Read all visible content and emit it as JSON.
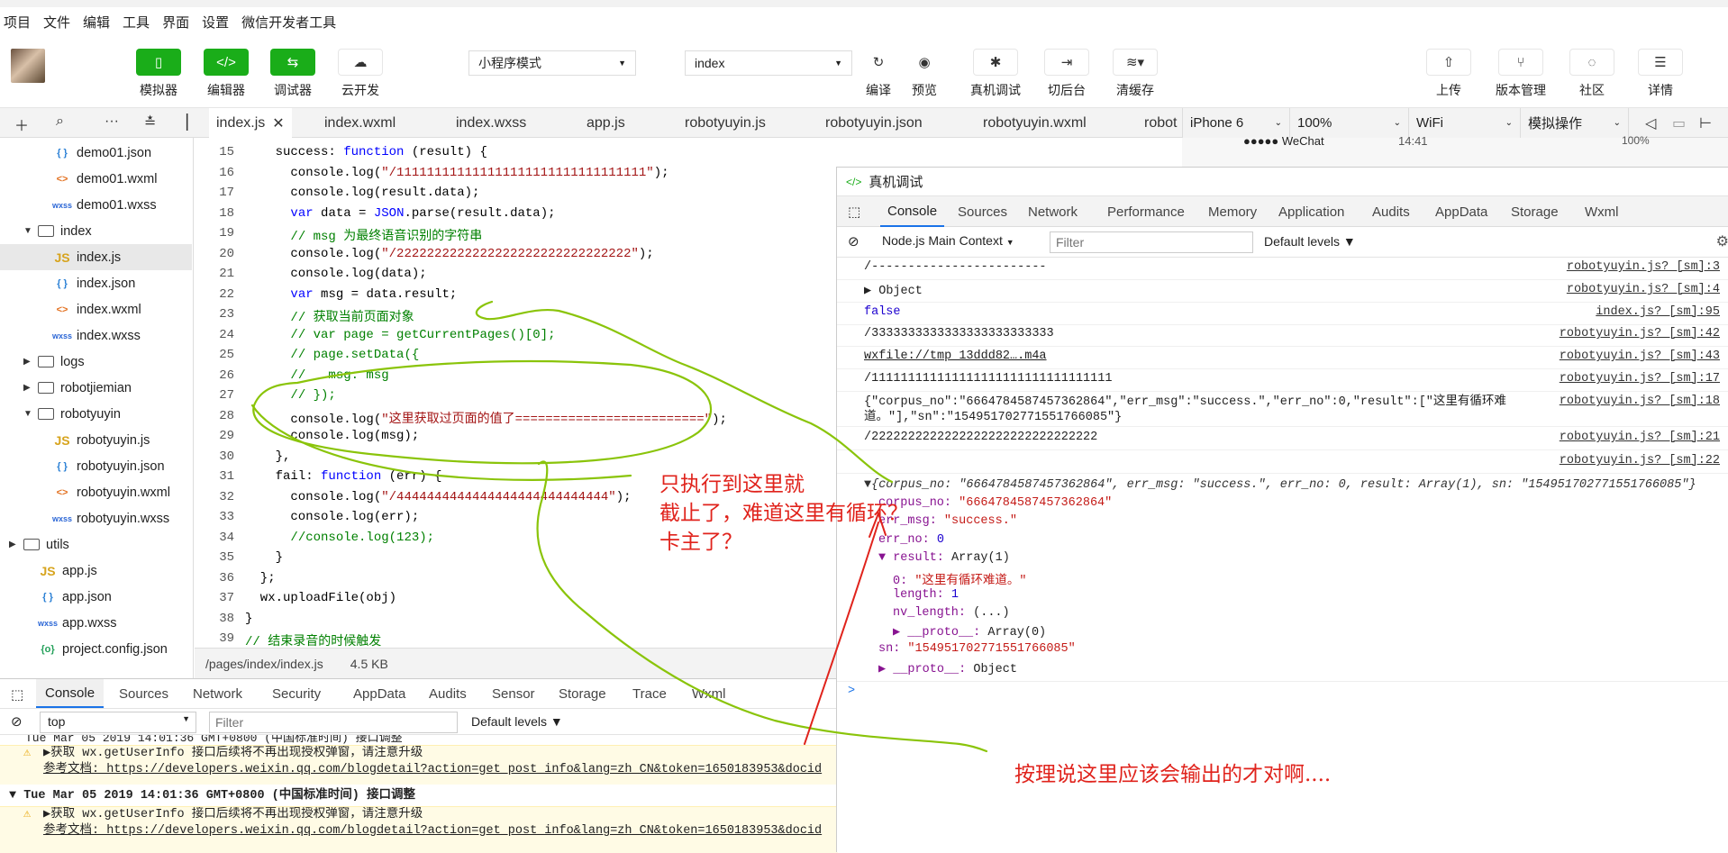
{
  "titlebar": {
    "text": "项目 - 微信开发者工具"
  },
  "menu": [
    "项目",
    "文件",
    "编辑",
    "工具",
    "界面",
    "设置",
    "微信开发者工具"
  ],
  "toolbar": {
    "green_buttons": [
      {
        "label": "模拟器",
        "icon": "phone-icon"
      },
      {
        "label": "编辑器",
        "icon": "code-icon"
      },
      {
        "label": "调试器",
        "icon": "debug-icon"
      }
    ],
    "cloud_label": "云开发",
    "mode_select": "小程序模式",
    "page_select": "index",
    "compile_label": "编译",
    "preview_label": "预览",
    "real_debug_label": "真机调试",
    "background_label": "切后台",
    "clear_cache_label": "清缓存",
    "upload_label": "上传",
    "version_label": "版本管理",
    "community_label": "社区",
    "detail_label": "详情"
  },
  "file_tabs": [
    "index.js",
    "index.wxml",
    "index.wxss",
    "app.js",
    "robotyuyin.js",
    "robotyuyin.json",
    "robotyuyin.wxml",
    "robot"
  ],
  "simulator_bar": {
    "device": "iPhone 6",
    "zoom": "100%",
    "network": "WiFi",
    "mode": "模拟操作"
  },
  "phone_status": {
    "carrier": "●●●●● WeChat",
    "time": "14:41",
    "battery": "100%"
  },
  "file_tree": [
    {
      "name": "demo01.json",
      "type": "json",
      "indent": 2
    },
    {
      "name": "demo01.wxml",
      "type": "wxml",
      "indent": 2
    },
    {
      "name": "demo01.wxss",
      "type": "wxss",
      "indent": 2
    },
    {
      "name": "index",
      "type": "folder-open",
      "indent": 1
    },
    {
      "name": "index.js",
      "type": "js",
      "indent": 2
    },
    {
      "name": "index.json",
      "type": "json",
      "indent": 2
    },
    {
      "name": "index.wxml",
      "type": "wxml",
      "indent": 2
    },
    {
      "name": "index.wxss",
      "type": "wxss",
      "indent": 2
    },
    {
      "name": "logs",
      "type": "folder",
      "indent": 1
    },
    {
      "name": "robotjiemian",
      "type": "folder",
      "indent": 1
    },
    {
      "name": "robotyuyin",
      "type": "folder-open",
      "indent": 1
    },
    {
      "name": "robotyuyin.js",
      "type": "js",
      "indent": 2
    },
    {
      "name": "robotyuyin.json",
      "type": "json",
      "indent": 2
    },
    {
      "name": "robotyuyin.wxml",
      "type": "wxml",
      "indent": 2
    },
    {
      "name": "robotyuyin.wxss",
      "type": "wxss",
      "indent": 2
    },
    {
      "name": "utils",
      "type": "folder",
      "indent": 0
    },
    {
      "name": "app.js",
      "type": "js",
      "indent": 1
    },
    {
      "name": "app.json",
      "type": "json",
      "indent": 1
    },
    {
      "name": "app.wxss",
      "type": "wxss",
      "indent": 1
    },
    {
      "name": "project.config.json",
      "type": "cfg",
      "indent": 1
    }
  ],
  "code_lines": [
    {
      "n": "15",
      "t": "    success: function (result) {"
    },
    {
      "n": "16",
      "t": "      console.log(\"/111111111111111111111111111111111\");"
    },
    {
      "n": "17",
      "t": "      console.log(result.data);"
    },
    {
      "n": "18",
      "t": "      var data = JSON.parse(result.data);"
    },
    {
      "n": "19",
      "t": "      // msg 为最终语音识别的字符串"
    },
    {
      "n": "20",
      "t": "      console.log(\"/2222222222222222222222222222222\");"
    },
    {
      "n": "21",
      "t": "      console.log(data);"
    },
    {
      "n": "22",
      "t": "      var msg = data.result;"
    },
    {
      "n": "23",
      "t": "      // 获取当前页面对象"
    },
    {
      "n": "24",
      "t": "      // var page = getCurrentPages()[0];"
    },
    {
      "n": "25",
      "t": "      // page.setData({"
    },
    {
      "n": "26",
      "t": "      //   msg: msg"
    },
    {
      "n": "27",
      "t": "      // });"
    },
    {
      "n": "28",
      "t": "      console.log(\"这里获取过页面的值了=========================\");"
    },
    {
      "n": "29",
      "t": "      console.log(msg);"
    },
    {
      "n": "30",
      "t": "    },"
    },
    {
      "n": "31",
      "t": "    fail: function (err) {"
    },
    {
      "n": "32",
      "t": "      console.log(\"/4444444444444444444444444444\");"
    },
    {
      "n": "33",
      "t": "      console.log(err);"
    },
    {
      "n": "34",
      "t": "      //console.log(123);"
    },
    {
      "n": "35",
      "t": "    }"
    },
    {
      "n": "36",
      "t": "  };"
    },
    {
      "n": "37",
      "t": "  wx.uploadFile(obj)"
    },
    {
      "n": "38",
      "t": "}"
    },
    {
      "n": "39",
      "t": "// 结束录音的时候触发"
    }
  ],
  "editor_status": {
    "path": "/pages/index/index.js",
    "size": "4.5 KB"
  },
  "bottom_panel": {
    "tabs": [
      "Console",
      "Sources",
      "Network",
      "Security",
      "AppData",
      "Audits",
      "Sensor",
      "Storage",
      "Trace",
      "Wxml"
    ],
    "context": "top",
    "filter_placeholder": "Filter",
    "levels": "Default levels",
    "log_cut": "Tue Mar 05 2019 14:01:36 GMT+0800 (中国标准时间) 接口调整",
    "warn1_a": "▶获取 wx.getUserInfo 接口后续将不再出现授权弹窗，请注意升级",
    "warn1_b": "参考文档: https://developers.weixin.qq.com/blogdetail?action=get_post_info&lang=zh_CN&token=1650183953&docid",
    "log_head": "Tue Mar 05 2019 14:01:36 GMT+0800 (中国标准时间) 接口调整",
    "warn2_a": "▶获取 wx.getUserInfo 接口后续将不再出现授权弹窗，请注意升级",
    "warn2_b": "参考文档: https://developers.weixin.qq.com/blogdetail?action=get_post_info&lang=zh_CN&token=1650183953&docid"
  },
  "remote_debug": {
    "title": "真机调试",
    "tabs": [
      "Console",
      "Sources",
      "Network",
      "Performance",
      "Memory",
      "Application",
      "Audits",
      "AppData",
      "Storage",
      "Wxml"
    ],
    "context": "Node.js Main Context",
    "filter_placeholder": "Filter",
    "levels": "Default levels",
    "rows": [
      {
        "msg": "/------------------------",
        "src": "robotyuyin.js? [sm]:3"
      },
      {
        "msg": "▶ Object",
        "src": "robotyuyin.js? [sm]:4"
      },
      {
        "msg": "false",
        "src": "index.js? [sm]:95"
      },
      {
        "msg": "/3333333333333333333333333",
        "src": "robotyuyin.js? [sm]:42"
      },
      {
        "msg": "wxfile://tmp_13ddd82….m4a",
        "src": "robotyuyin.js? [sm]:43"
      },
      {
        "msg": "/111111111111111111111111111111111",
        "src": "robotyuyin.js? [sm]:17"
      },
      {
        "msg": "{\"corpus_no\":\"6664784587457362864\",\"err_msg\":\"success.\",\"err_no\":0,\"result\":[\"这里有循环难",
        "msg2": "道。\"],\"sn\":\"154951702771551766085\"}",
        "src": "robotyuyin.js? [sm]:18"
      },
      {
        "msg": "/2222222222222222222222222222222",
        "src": "robotyuyin.js? [sm]:21"
      },
      {
        "msg": "",
        "src": "robotyuyin.js? [sm]:22"
      }
    ],
    "obj_summary": "▼{corpus_no: \"6664784587457362864\", err_msg: \"success.\", err_no: 0, result: Array(1), sn: \"154951702771551766085\"}",
    "obj_lines": [
      {
        "k": "corpus_no",
        "v": "\"6664784587457362864\"",
        "vt": "s",
        "i": 1
      },
      {
        "k": "err_msg",
        "v": "\"success.\"",
        "vt": "s",
        "i": 1
      },
      {
        "k": "err_no",
        "v": "0",
        "vt": "n",
        "i": 1
      },
      {
        "k": "▼ result",
        "v": "Array(1)",
        "vt": "p",
        "i": 1
      },
      {
        "k": "0",
        "v": "\"这里有循环难道。\"",
        "vt": "s",
        "i": 2
      },
      {
        "k": "length",
        "v": "1",
        "vt": "n",
        "i": 2
      },
      {
        "k": "nv_length",
        "v": "(...)",
        "vt": "p",
        "i": 2
      },
      {
        "k": "▶ __proto__",
        "v": "Array(0)",
        "vt": "p",
        "i": 2
      },
      {
        "k": "sn",
        "v": "\"154951702771551766085\"",
        "vt": "s",
        "i": 1
      },
      {
        "k": "▶ __proto__",
        "v": "Object",
        "vt": "p",
        "i": 1
      }
    ],
    "prompt": ">"
  },
  "annotations": {
    "note1": [
      "只执行到这里就",
      "截止了，难道这里有循环？",
      "卡主了？"
    ],
    "note2": "按理说这里应该会输出的才对啊...."
  },
  "colors": {
    "green": "#1aad19",
    "annotation_red": "#e0231c",
    "annotation_green": "#8ac40a"
  }
}
